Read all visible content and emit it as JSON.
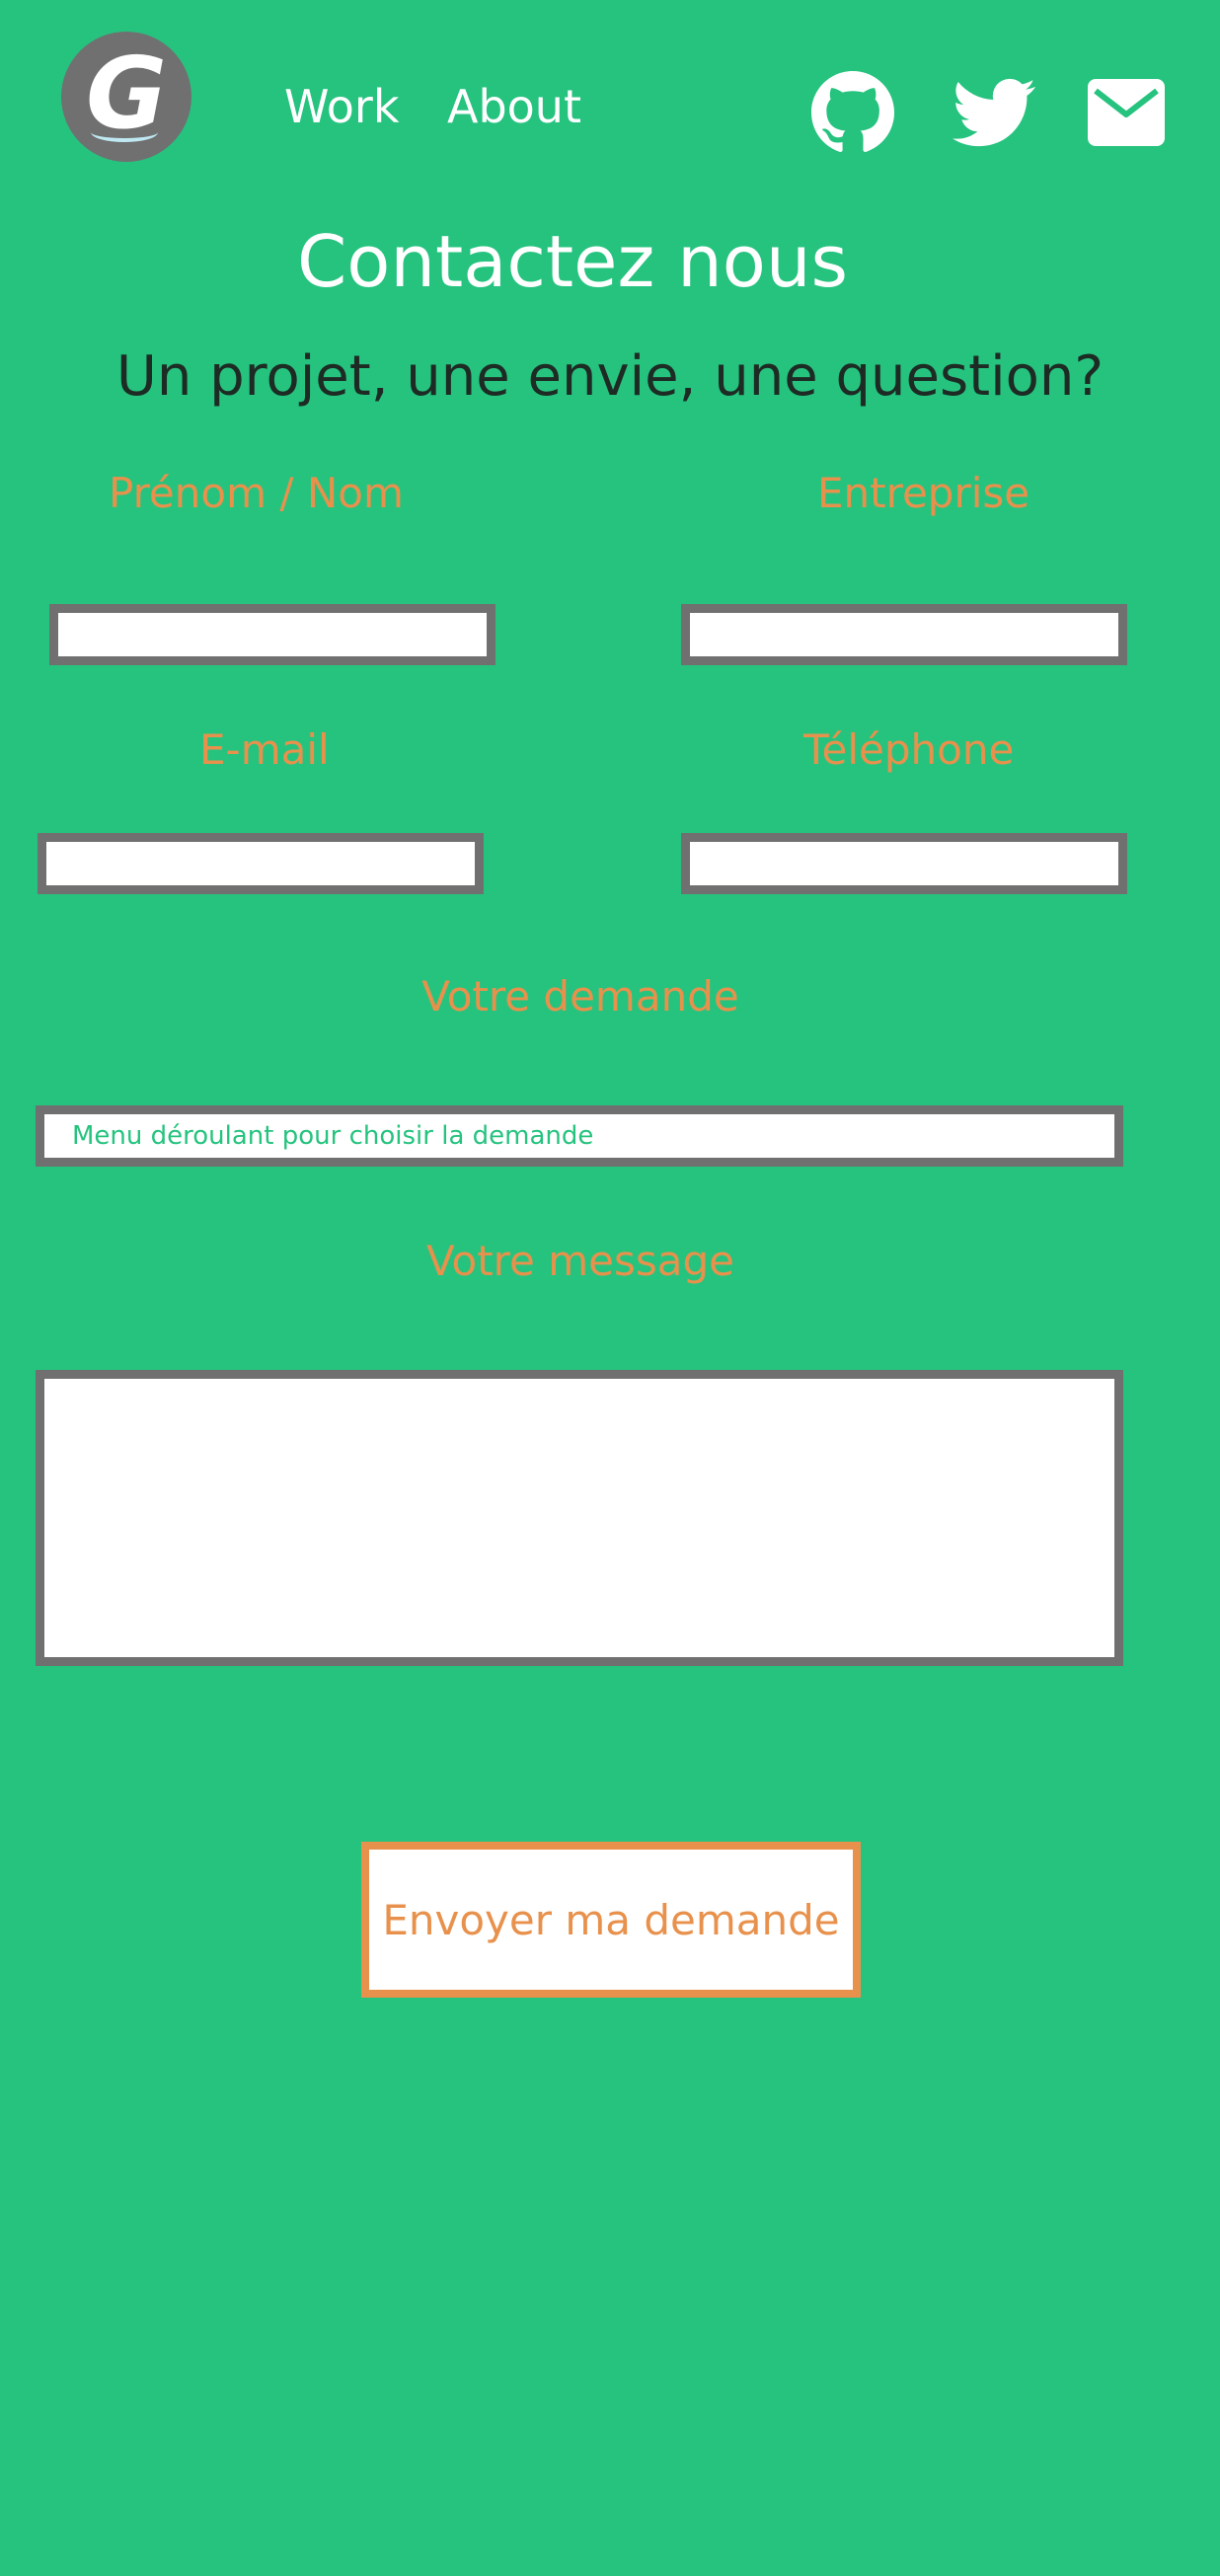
{
  "header": {
    "logo_letter": "G",
    "nav": {
      "work": "Work",
      "about": "About"
    }
  },
  "social": {
    "github_icon": "github-icon",
    "twitter_icon": "twitter-icon",
    "mail_icon": "mail-icon"
  },
  "page": {
    "title": "Contactez nous",
    "subtitle": "Un projet, une envie, une question?"
  },
  "form": {
    "name_label": "Prénom / Nom",
    "company_label": "Entreprise",
    "email_label": "E-mail",
    "phone_label": "Téléphone",
    "request_label": "Votre demande",
    "request_value": "Menu déroulant pour choisir la demande",
    "message_label": "Votre message",
    "submit_label": "Envoyer ma demande"
  },
  "colors": {
    "background": "#26c37f",
    "accent": "#e8914c",
    "field_border": "#707070",
    "logo_bg": "#707070"
  }
}
